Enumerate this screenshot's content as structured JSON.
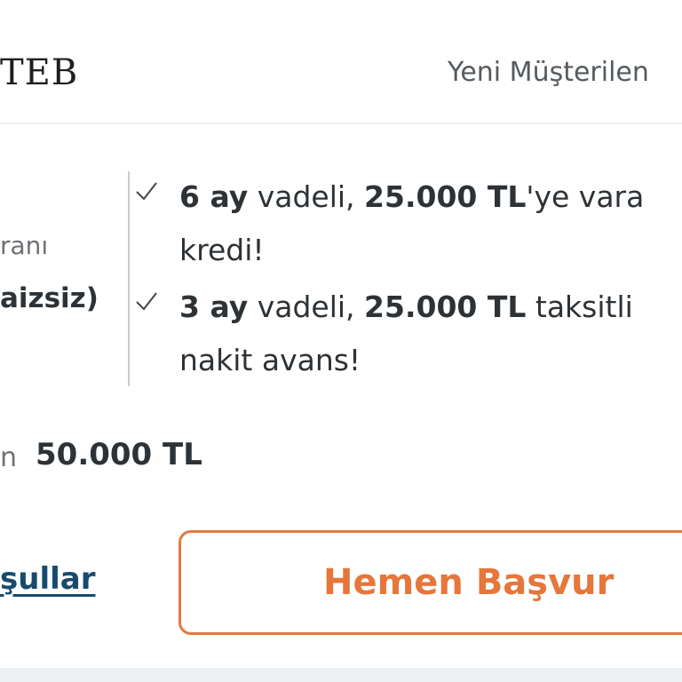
{
  "header": {
    "logo": "TEB",
    "nav_link": "Yeni Müşterilen"
  },
  "rate": {
    "label": "ranı",
    "value": "aizsiz)"
  },
  "benefits": [
    {
      "highlight1": "6 ay",
      "text1": " vadeli, ",
      "highlight2": "25.000 TL",
      "text2": "'ye vara",
      "line2": "kredi!"
    },
    {
      "highlight1": "3 ay",
      "text1": " vadeli, ",
      "highlight2": "25.000 TL",
      "text2": " taksitli",
      "line2": "nakit avans!"
    }
  ],
  "amount": {
    "label": "n",
    "value": "50.000 TL"
  },
  "actions": {
    "terms_label": "şullar",
    "apply_label": "Hemen Başvur"
  },
  "colors": {
    "accent": "#e6763a",
    "link": "#174b6d",
    "text": "#2d3236"
  },
  "icons": {
    "check": "check-icon"
  }
}
